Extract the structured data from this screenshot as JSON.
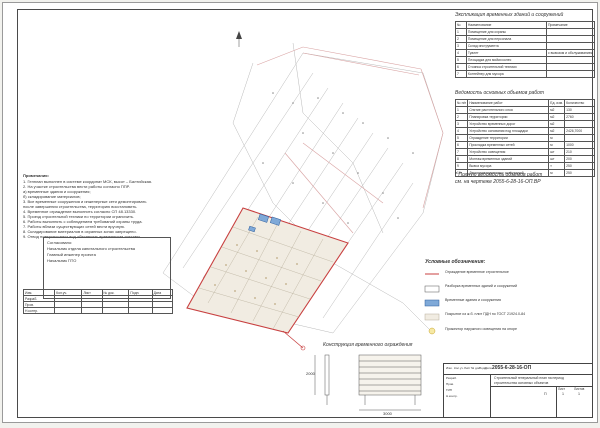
{
  "explication": {
    "title": "Экспликация временных зданий и сооружений",
    "headers": [
      "№",
      "Наименование",
      "Примечание"
    ],
    "rows": [
      {
        "n": "1",
        "name": "Помещение для охраны",
        "note": ""
      },
      {
        "n": "2",
        "name": "Помещение для персонала",
        "note": ""
      },
      {
        "n": "3",
        "name": "Склад инструмента",
        "note": ""
      },
      {
        "n": "4",
        "name": "Туалет",
        "note": "с вывозом и обслуживанием"
      },
      {
        "n": "5",
        "name": "Площадка для мойки колес",
        "note": ""
      },
      {
        "n": "6",
        "name": "Стоянка строительной техники",
        "note": ""
      },
      {
        "n": "7",
        "name": "Контейнер для мусора",
        "note": ""
      }
    ]
  },
  "volumes": {
    "title": "Ведомость основных объемов работ",
    "headers": [
      "№ п/п",
      "Наименование работ",
      "Ед. изм.",
      "Количество"
    ],
    "rows": [
      {
        "n": "1",
        "name": "Снятие растительного слоя",
        "unit": "м2",
        "qty": "130"
      },
      {
        "n": "2",
        "name": "Планировка территории",
        "unit": "м2",
        "qty": "2760"
      },
      {
        "n": "3",
        "name": "Устройство временных дорог",
        "unit": "м2",
        "qty": ""
      },
      {
        "n": "4",
        "name": "Устройство основания под площадки",
        "unit": "м2",
        "qty": "2426,7000"
      },
      {
        "n": "5",
        "name": "Ограждение территории",
        "unit": "м",
        "qty": ""
      },
      {
        "n": "6",
        "name": "Прокладка временных сетей",
        "unit": "м",
        "qty": "1000"
      },
      {
        "n": "7",
        "name": "Устройство освещения",
        "unit": "шт",
        "qty": "210"
      },
      {
        "n": "8",
        "name": "Монтаж временных зданий",
        "unit": "шт",
        "qty": "200"
      },
      {
        "n": "9",
        "name": "Вывоз мусора",
        "unit": "т",
        "qty": "250"
      },
      {
        "n": "10",
        "name": "Демонтаж временных сооружений",
        "unit": "м",
        "qty": "250"
      }
    ],
    "footnote_1": "* Полную ведомость объемов работ",
    "footnote_2": "см. на чертеже 2055-6-28-16-ОП.ВР"
  },
  "notes": {
    "title": "Примечания:",
    "lines": [
      "1. Генплан выполнен в системе координат МСК, высот – Балтийская.",
      "2. На участке строительства вести работы согласно ППР.",
      "   а) временные здания и сооружения;",
      "   б) складирование материалов;",
      "3. Все временные сооружения и инженерные сети демонтировать",
      "   после завершения строительства, территорию восстановить.",
      "4. Временное ограждение выполнить согласно СП 48.13330.",
      "5. Проезд строительной техники по территории ограничить.",
      "6. Работы выполнять с соблюдением требований охраны труда.",
      "7. Работы вблизи существующих сетей вести вручную.",
      "8. Складирование материалов в охранных зонах запрещено.",
      "9. Отвод поверхностных вод обеспечить временными лотками."
    ]
  },
  "approval": {
    "lines": [
      "Согласовано:",
      "Начальник отдела капитального строительства",
      "Главный инженер проекта",
      "Начальник ПТО"
    ],
    "stamp_rows": [
      [
        "Изм.",
        "Кол.уч.",
        "Лист",
        "№ док.",
        "Подп.",
        "Дата"
      ],
      [
        "Разраб.",
        "",
        "",
        "",
        "",
        ""
      ],
      [
        "Пров.",
        "",
        "",
        "",
        "",
        ""
      ],
      [
        "Н.контр.",
        "",
        "",
        "",
        "",
        ""
      ]
    ]
  },
  "legend": {
    "title": "Условные обозначения:",
    "items": [
      {
        "sym": "fence",
        "label": "Ограждение временное строительное"
      },
      {
        "sym": "box",
        "label": "Разборка временных зданий и сооружений"
      },
      {
        "sym": "hatch-blue",
        "label": "Временные здания и сооружения"
      },
      {
        "sym": "box-light",
        "label": "Покрытие из ж.б. плит ПДН по ГОСТ 21924.0-84"
      },
      {
        "sym": "circle",
        "label": "Прожектор наружного освещения на опоре"
      }
    ]
  },
  "fence_detail": {
    "title": "Конструкция временного ограждения",
    "dim_h": "2000",
    "dim_w": "3000"
  },
  "stamp": {
    "code": "2055-6-28-16-ОП",
    "org_line_1": "Строительный генеральный план на период",
    "org_line_2": "строительства основных объектов",
    "sheet_label": "Лист",
    "sheets_label": "Листов",
    "stage": "П",
    "sheet": "1",
    "sheets": "1",
    "row_labels": [
      "Изм.",
      "Кол.уч.",
      "Лист",
      "№ док.",
      "Подп.",
      "Дата"
    ],
    "people": [
      "Разраб.",
      "Пров.",
      "ГИП",
      "Н.контр."
    ]
  }
}
